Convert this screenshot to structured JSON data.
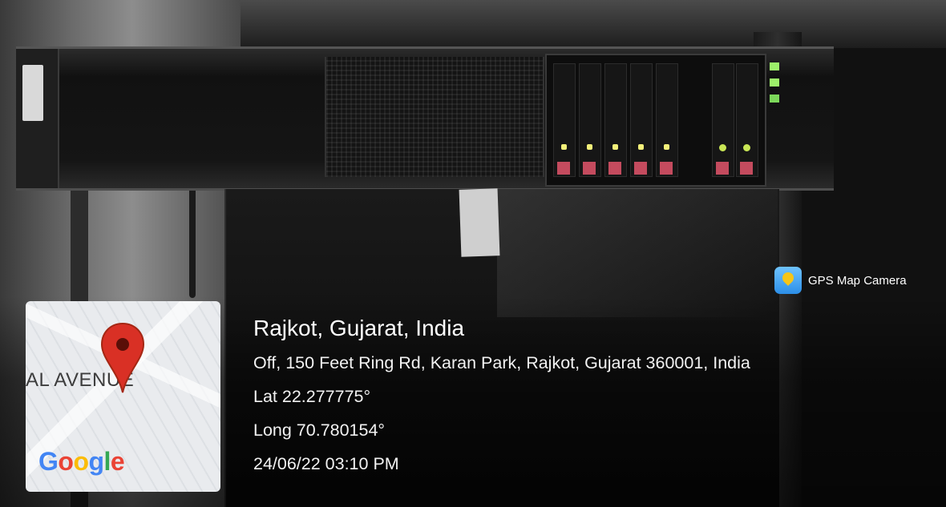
{
  "stamp": {
    "brand_label": "GPS Map Camera",
    "place": "Rajkot, Gujarat, India",
    "address": "Off, 150 Feet Ring Rd, Karan Park, Rajkot, Gujarat 360001, India",
    "lat": "Lat 22.277775°",
    "long": "Long 70.780154°",
    "datetime": "24/06/22 03:10 PM"
  },
  "map": {
    "street_label": "AL AVENUE",
    "logo": [
      "G",
      "o",
      "o",
      "g",
      "l",
      "e"
    ],
    "pin_color": "#d93025"
  },
  "icons": {
    "brand": "gps-map-camera-icon",
    "pin": "map-pin-icon"
  }
}
